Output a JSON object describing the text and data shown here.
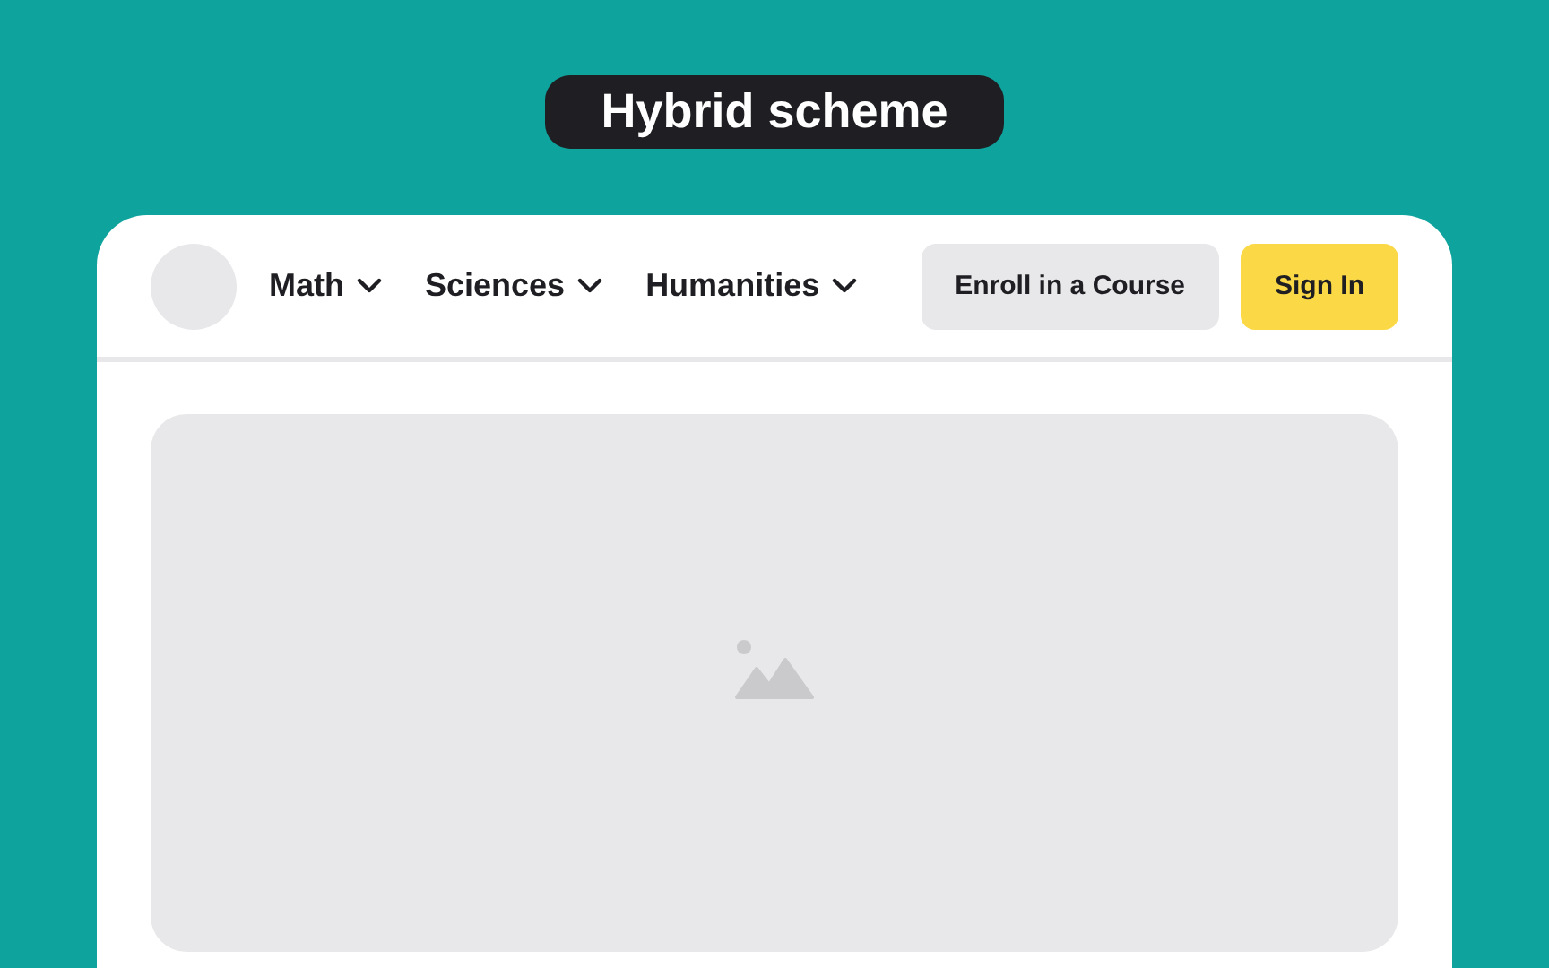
{
  "title": "Hybrid scheme",
  "nav": {
    "items": [
      {
        "label": "Math"
      },
      {
        "label": "Sciences"
      },
      {
        "label": "Humanities"
      }
    ]
  },
  "buttons": [
    {
      "label": "Enroll in a Course",
      "kind": "secondary"
    },
    {
      "label": "Sign In",
      "kind": "primary"
    }
  ]
}
